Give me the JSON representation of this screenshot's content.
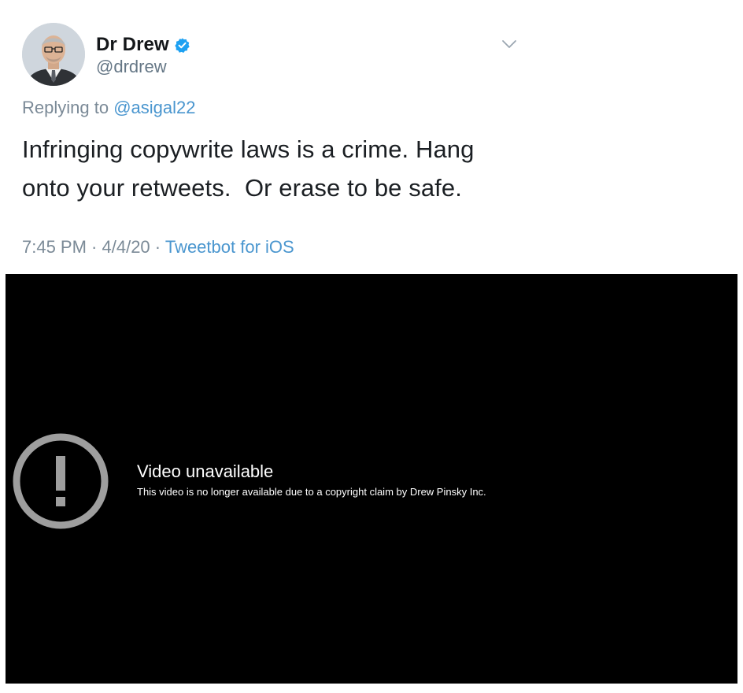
{
  "tweet": {
    "author": {
      "display_name": "Dr Drew",
      "handle": "@drdrew",
      "verified": true,
      "avatar_icon": "avatar-photo"
    },
    "reply": {
      "prefix": "Replying to ",
      "mention": "@asigal22"
    },
    "text_lines": [
      "Infringing copywrite laws is a crime. Hang",
      "onto your retweets.  Or erase to be safe."
    ],
    "meta": {
      "time": "7:45 PM",
      "separator1": " · ",
      "date": "4/4/20",
      "separator2": " · ",
      "source": "Tweetbot for iOS"
    },
    "colors": {
      "link": "#4a96cf",
      "secondary_text": "#7b8a97",
      "verified_badge": "#1da1f2"
    },
    "icons": {
      "verified": "verified-badge-icon",
      "menu": "chevron-down-icon"
    }
  },
  "video": {
    "title": "Video unavailable",
    "message": "This video is no longer available due to a copyright claim by Drew Pinsky Inc.",
    "icon": "alert-circle-icon",
    "colors": {
      "background": "#000000",
      "icon": "#9e9e9e",
      "text": "#ffffff"
    }
  }
}
